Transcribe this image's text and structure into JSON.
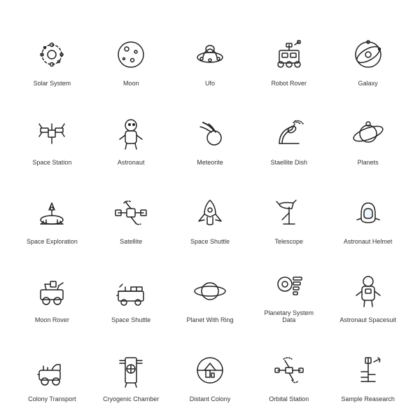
{
  "icons": [
    {
      "id": "solar-system",
      "label": "Solar System"
    },
    {
      "id": "moon",
      "label": "Moon"
    },
    {
      "id": "ufo",
      "label": "Ufo"
    },
    {
      "id": "robot-rover",
      "label": "Robot Rover"
    },
    {
      "id": "galaxy",
      "label": "Galaxy"
    },
    {
      "id": "space-station",
      "label": "Space Station"
    },
    {
      "id": "astronaut",
      "label": "Astronaut"
    },
    {
      "id": "meteorite",
      "label": "Meteorite"
    },
    {
      "id": "satellite-dish",
      "label": "Staellite Dish"
    },
    {
      "id": "planets",
      "label": "Planets"
    },
    {
      "id": "space-exploration",
      "label": "Space Exploration"
    },
    {
      "id": "satellite",
      "label": "Satellite"
    },
    {
      "id": "space-shuttle-1",
      "label": "Space Shuttle"
    },
    {
      "id": "telescope",
      "label": "Telescope"
    },
    {
      "id": "astronaut-helmet",
      "label": "Astronaut Helmet"
    },
    {
      "id": "moon-rover",
      "label": "Moon Rover"
    },
    {
      "id": "space-shuttle-2",
      "label": "Space Shuttle"
    },
    {
      "id": "planet-with-ring",
      "label": "Planet With Ring"
    },
    {
      "id": "planetary-system-data",
      "label": "Planetary System Data"
    },
    {
      "id": "astronaut-spacesuit",
      "label": "Astronaut Spacesuit"
    },
    {
      "id": "colony-transport",
      "label": "Colony Transport"
    },
    {
      "id": "cryogenic-chamber",
      "label": "Cryogenic Chamber"
    },
    {
      "id": "distant-colony",
      "label": "Distant Colony"
    },
    {
      "id": "orbital-station",
      "label": "Orbital Station"
    },
    {
      "id": "sample-research",
      "label": "Sample Reasearch"
    }
  ]
}
